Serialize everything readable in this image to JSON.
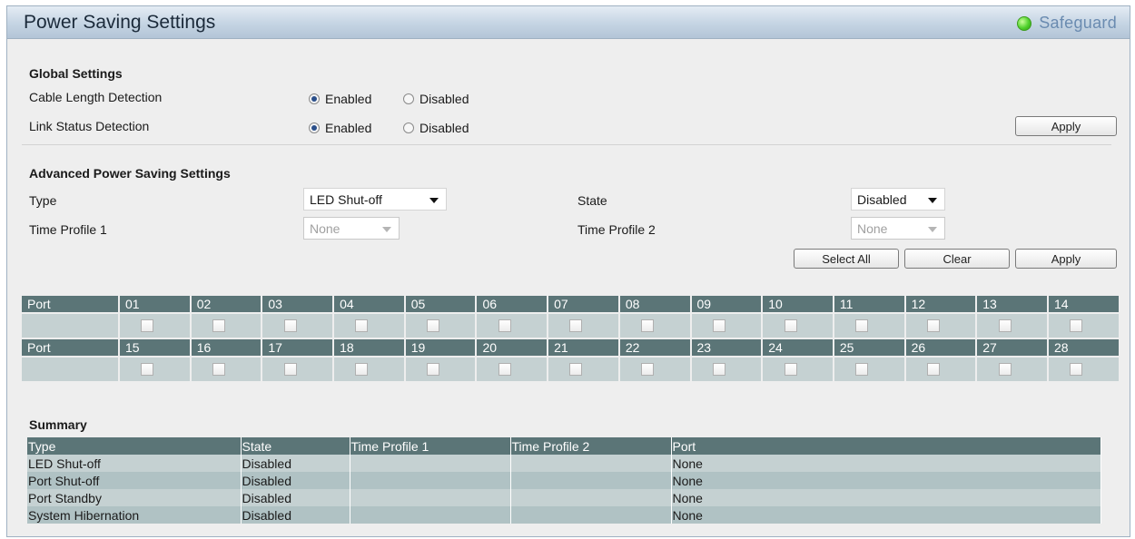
{
  "header": {
    "title": "Power Saving Settings",
    "safeguard": "Safeguard"
  },
  "global": {
    "title": "Global Settings",
    "rows": [
      {
        "label": "Cable Length Detection",
        "enabled": "Enabled",
        "disabled": "Disabled",
        "selected": "Enabled"
      },
      {
        "label": "Link Status Detection",
        "enabled": "Enabled",
        "disabled": "Disabled",
        "selected": "Enabled"
      }
    ],
    "apply": "Apply"
  },
  "advanced": {
    "title": "Advanced Power Saving Settings",
    "type_label": "Type",
    "type_value": "LED Shut-off",
    "state_label": "State",
    "state_value": "Disabled",
    "tp1_label": "Time Profile 1",
    "tp1_value": "None",
    "tp2_label": "Time Profile 2",
    "tp2_value": "None",
    "select_all": "Select All",
    "clear": "Clear",
    "apply": "Apply"
  },
  "ports": {
    "header_label": "Port",
    "rows": [
      [
        "01",
        "02",
        "03",
        "04",
        "05",
        "06",
        "07",
        "08",
        "09",
        "10",
        "11",
        "12",
        "13",
        "14"
      ],
      [
        "15",
        "16",
        "17",
        "18",
        "19",
        "20",
        "21",
        "22",
        "23",
        "24",
        "25",
        "26",
        "27",
        "28"
      ]
    ]
  },
  "summary": {
    "title": "Summary",
    "columns": [
      "Type",
      "State",
      "Time Profile 1",
      "Time Profile 2",
      "Port"
    ],
    "rows": [
      [
        "LED Shut-off",
        "Disabled",
        "",
        "",
        "None"
      ],
      [
        "Port Shut-off",
        "Disabled",
        "",
        "",
        "None"
      ],
      [
        "Port Standby",
        "Disabled",
        "",
        "",
        "None"
      ],
      [
        "System Hibernation",
        "Disabled",
        "",
        "",
        "None"
      ]
    ]
  }
}
